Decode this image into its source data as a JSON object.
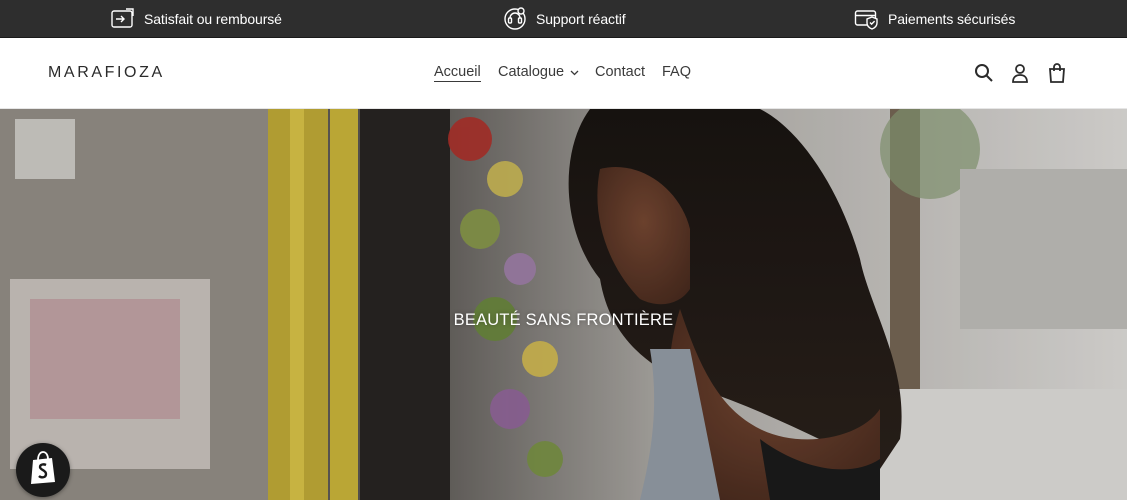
{
  "announcement": {
    "features": [
      {
        "label": "Satisfait ou remboursé",
        "icon": "money-back-icon"
      },
      {
        "label": "Support réactif",
        "icon": "support-agent-icon"
      },
      {
        "label": "Paiements sécurisés",
        "icon": "secure-payment-icon"
      }
    ]
  },
  "header": {
    "logo": "MARAFIOZA",
    "nav": [
      {
        "label": "Accueil",
        "active": true
      },
      {
        "label": "Catalogue",
        "has_dropdown": true
      },
      {
        "label": "Contact"
      },
      {
        "label": "FAQ"
      }
    ],
    "icons": [
      "search-icon",
      "account-icon",
      "cart-icon"
    ]
  },
  "hero": {
    "title": "BEAUTÉ SANS FRONTIÈRE"
  },
  "badge": {
    "icon": "shopify-bag-icon"
  },
  "colors": {
    "topbar_bg": "#2e2e2e",
    "text_dark": "#3a3a3a",
    "white": "#ffffff"
  }
}
